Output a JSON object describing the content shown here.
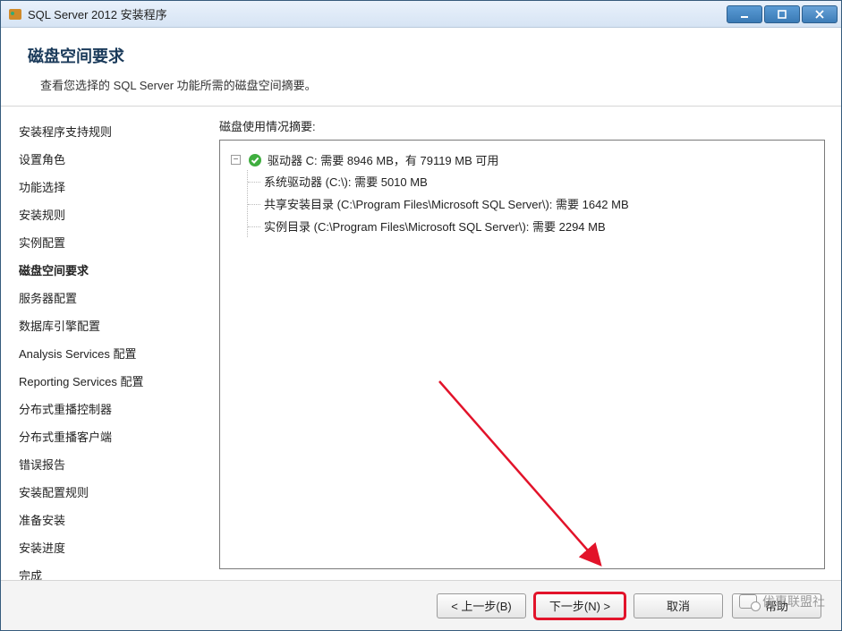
{
  "window": {
    "title": "SQL Server 2012 安装程序"
  },
  "header": {
    "title": "磁盘空间要求",
    "subtitle": "查看您选择的 SQL Server 功能所需的磁盘空间摘要。"
  },
  "sidebar": {
    "steps": [
      "安装程序支持规则",
      "设置角色",
      "功能选择",
      "安装规则",
      "实例配置",
      "磁盘空间要求",
      "服务器配置",
      "数据库引擎配置",
      "Analysis Services 配置",
      "Reporting Services 配置",
      "分布式重播控制器",
      "分布式重播客户端",
      "错误报告",
      "安装配置规则",
      "准备安装",
      "安装进度",
      "完成"
    ],
    "currentIndex": 5
  },
  "main": {
    "label": "磁盘使用情况摘要:",
    "drive_summary": "驱动器 C: 需要 8946 MB，有 79119 MB 可用",
    "children": [
      "系统驱动器 (C:\\): 需要 5010 MB",
      "共享安装目录 (C:\\Program Files\\Microsoft SQL Server\\): 需要 1642 MB",
      "实例目录 (C:\\Program Files\\Microsoft SQL Server\\): 需要 2294 MB"
    ]
  },
  "footer": {
    "back": "< 上一步(B)",
    "next": "下一步(N) >",
    "cancel": "取消",
    "help": "帮助"
  },
  "watermark": {
    "text": "优惠联盟社"
  }
}
